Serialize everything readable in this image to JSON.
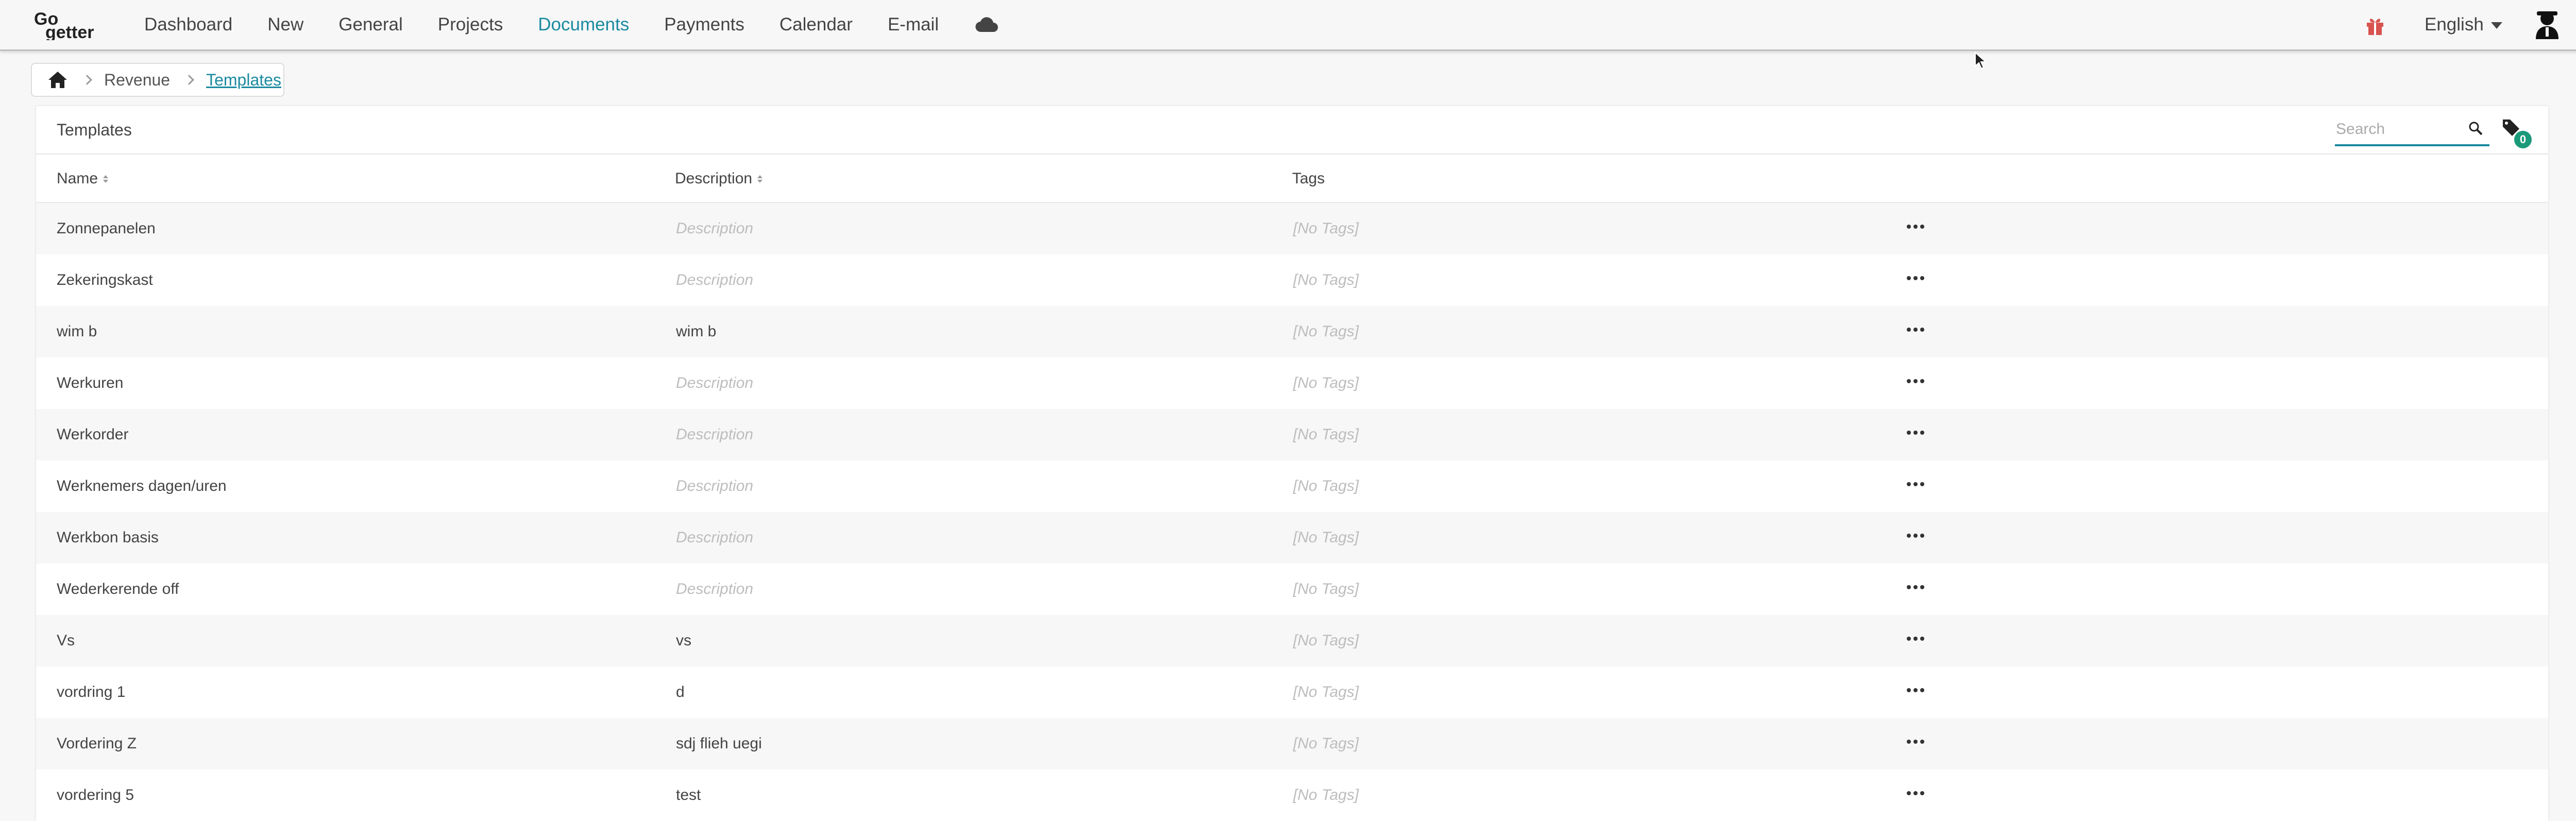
{
  "nav": {
    "items": [
      "Dashboard",
      "New",
      "General",
      "Projects",
      "Documents",
      "Payments",
      "Calendar",
      "E-mail"
    ],
    "active": "Documents",
    "cloud_icon": "cloud-icon",
    "language": "English",
    "gift_icon": "gift-icon",
    "avatar_icon": "user-avatar-icon"
  },
  "logo": {
    "top": "Go",
    "bottom": "getter"
  },
  "breadcrumb": {
    "home_icon": "home-icon",
    "parent": "Revenue",
    "current": "Templates"
  },
  "panel": {
    "title": "Templates",
    "search_placeholder": "Search",
    "tag_filter_count": "0"
  },
  "table": {
    "headers": {
      "name": "Name",
      "description": "Description",
      "tags": "Tags"
    },
    "description_placeholder": "Description",
    "no_tags": "[No Tags]",
    "rows": [
      {
        "name": "Zonnepanelen",
        "description": ""
      },
      {
        "name": "Zekeringskast",
        "description": ""
      },
      {
        "name": "wim b",
        "description": "wim b"
      },
      {
        "name": "Werkuren",
        "description": ""
      },
      {
        "name": "Werkorder",
        "description": ""
      },
      {
        "name": "Werknemers dagen/uren",
        "description": ""
      },
      {
        "name": "Werkbon basis",
        "description": ""
      },
      {
        "name": "Wederkerende off",
        "description": ""
      },
      {
        "name": "Vs",
        "description": "vs"
      },
      {
        "name": "vordring 1",
        "description": "d"
      },
      {
        "name": "Vordering Z",
        "description": "sdj flieh uegi"
      },
      {
        "name": "vordering 5",
        "description": "test"
      }
    ]
  },
  "colors": {
    "accent": "#1b8aa0",
    "badge": "#1b9a7a",
    "gift": "#d9534f"
  }
}
